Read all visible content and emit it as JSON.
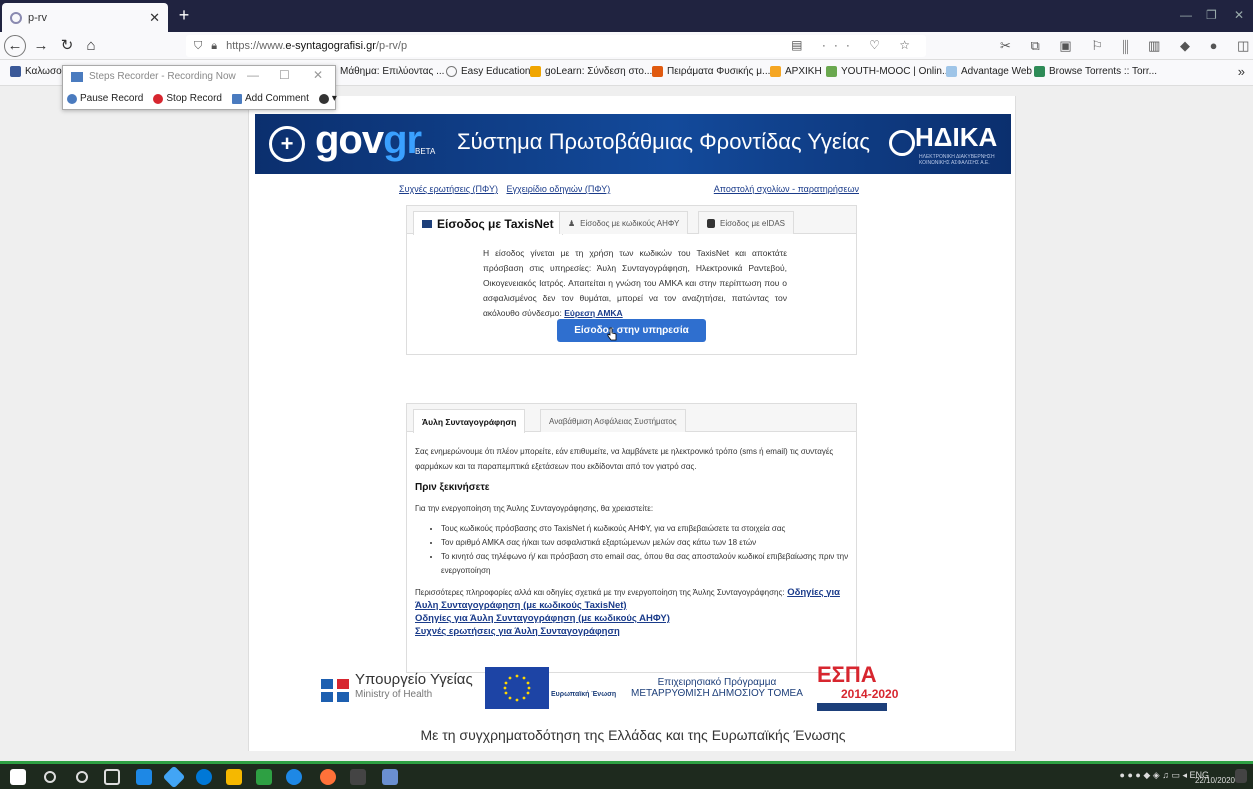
{
  "browser": {
    "tab_title": "p-rv",
    "url_prefix": "https://www.",
    "url_domain": "e-syntagografisi.gr",
    "url_path": "/p-rv/p",
    "bookmarks": [
      "Καλωσορ",
      "Μάθημα: Επιλύοντας ...",
      "Easy Education",
      "goLearn: Σύνδεση στο...",
      "Πειράματα Φυσικής μ...",
      "ΑΡΧΙΚΗ",
      "YOUTH-MOOC | Onlin...",
      "Advantage Web",
      "Browse Torrents :: Torr..."
    ]
  },
  "recorder": {
    "title": "Steps Recorder - Recording Now",
    "pause": "Pause Record",
    "stop": "Stop Record",
    "comment": "Add Comment"
  },
  "banner": {
    "gov": "gov",
    "gr": "gr",
    "beta": "BETA",
    "title": "Σύστημα Πρωτοβάθμιας Φροντίδας Υγείας",
    "idika": "ΗΔΙΚΑ",
    "idika_sub": "ΗΛΕΚΤΡΟΝΙΚΗ ΔΙΑΚΥΒΕΡΝΗΣΗ ΚΟΙΝΩΝΙΚΗΣ ΑΣΦΑΛΙΣΗΣ Α.Ε."
  },
  "links": {
    "faq": "Συχνές ερωτήσεις (ΠΦΥ)",
    "manual": "Εγχειρίδιο οδηγιών (ΠΦΥ)",
    "feedback": "Αποστολή σχολίων - παρατηρήσεων"
  },
  "login_panel": {
    "tabs": [
      "Είσοδος με TaxisNet",
      "Είσοδος με κωδικούς ΑΗΦΥ",
      "Είσοδος με eIDAS"
    ],
    "text": "Η είσοδος γίνεται με τη χρήση των κωδικών του TaxisNet και αποκτάτε πρόσβαση στις υπηρεσίες: Άυλη Συνταγογράφηση, Ηλεκτρονικά Ραντεβού, Οικογενειακός Ιατρός. Απαιτείται η γνώση του ΑΜΚΑ και στην περίπτωση που ο ασφαλισμένος δεν τον θυμάται, μπορεί να τον αναζητήσει, πατώντας τον ακόλουθο σύνδεσμο:",
    "amka_link": "Εύρεση ΑΜΚΑ",
    "button": "Είσοδος στην υπηρεσία"
  },
  "info_panel": {
    "tabs": [
      "Άυλη Συνταγογράφηση",
      "Αναβάθμιση Ασφάλειας Συστήματος"
    ],
    "intro": "Σας ενημερώνουμε ότι πλέον μπορείτε, εάν επιθυμείτε, να λαμβάνετε με ηλεκτρονικό τρόπο (sms ή email) τις συνταγές φαρμάκων και τα παραπεμπτικά εξετάσεων που εκδίδονται από τον γιατρό σας.",
    "heading": "Πριν ξεκινήσετε",
    "need": "Για την ενεργοποίηση της Άυλης Συνταγογράφησης, θα χρειαστείτε:",
    "items": [
      "Τους κωδικούς πρόσβασης στο TaxisNet ή κωδικούς ΑΗΦΥ, για να επιβεβαιώσετε τα στοιχεία σας",
      "Τον αριθμό ΑΜΚΑ σας ή/και των ασφαλιστικά εξαρτώμενων μελών σας κάτω των 18 ετών",
      "Το κινητό σας τηλέφωνο ή/ και πρόσβαση στο email σας, όπου θα σας αποσταλούν κωδικοί επιβεβαίωσης πριν την ενεργοποίηση"
    ],
    "more": "Περισσότερες πληροφορίες αλλά και οδηγίες σχετικά με την ενεργοποίηση της Άυλης Συνταγογράφησης:",
    "link1": "Οδηγίες για Άυλη Συνταγογράφηση (με κωδικούς TaxisNet)",
    "link2": "Οδηγίες για Άυλη Συνταγογράφηση (με κωδικούς ΑΗΦΥ)",
    "link3": "Συχνές ερωτήσεις για Άυλη Συνταγογράφηση"
  },
  "footer": {
    "ministry": "Υπουργείο Υγείας",
    "ministry_en": "Ministry of Health",
    "eu": "Ευρωπαϊκή Ένωση",
    "op_line1": "Επιχειρησιακό Πρόγραμμα",
    "op_line2": "ΜΕΤΑΡΡΥΘΜΙΣΗ ΔΗΜΟΣΙΟΥ ΤΟΜΕΑ",
    "espa": "ΕΣΠΑ",
    "espa_years": "2014-2020",
    "cofund": "Με τη συγχρηματοδότηση της Ελλάδας και της Ευρωπαϊκής Ένωσης"
  },
  "taskbar": {
    "lang": "ENG",
    "date": "22/10/2020"
  },
  "colors": {
    "banner": "#134a9b",
    "button": "#2f6fcf",
    "link": "#1a3b8a",
    "espa": "#d7262f"
  }
}
